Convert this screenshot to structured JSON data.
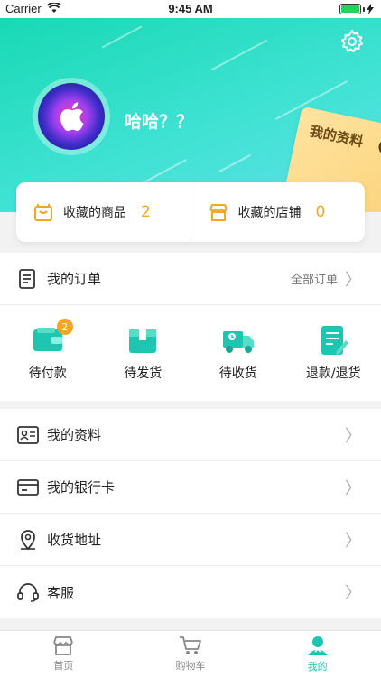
{
  "status_bar": {
    "carrier": "Carrier",
    "time": "9:45 AM"
  },
  "header": {
    "username": "哈哈？？",
    "card_label": "我的资料",
    "accent": "#1cc6b0"
  },
  "favorites": [
    {
      "label": "收藏的商品",
      "count": "2",
      "icon": "bag-icon"
    },
    {
      "label": "收藏的店铺",
      "count": "0",
      "icon": "shop-icon"
    }
  ],
  "orders": {
    "title": "我的订单",
    "all_label": "全部订单",
    "items": [
      {
        "label": "待付款",
        "icon": "wallet-icon",
        "badge": "2"
      },
      {
        "label": "待发货",
        "icon": "box-icon"
      },
      {
        "label": "待收货",
        "icon": "truck-icon"
      },
      {
        "label": "退款/退货",
        "icon": "refund-doc-icon"
      }
    ]
  },
  "menu": [
    {
      "label": "我的资料",
      "icon": "id-card-icon"
    },
    {
      "label": "我的银行卡",
      "icon": "bank-card-icon"
    },
    {
      "label": "收货地址",
      "icon": "location-pin-icon"
    },
    {
      "label": "客服",
      "icon": "headset-icon"
    }
  ],
  "tabbar": [
    {
      "label": "首页",
      "icon": "storefront-icon",
      "active": false
    },
    {
      "label": "购物车",
      "icon": "cart-icon",
      "active": false
    },
    {
      "label": "我的",
      "icon": "user-icon",
      "active": true
    }
  ],
  "colors": {
    "teal": "#1cc6b0",
    "orange": "#f5a623",
    "gold": "#fbd37a"
  }
}
